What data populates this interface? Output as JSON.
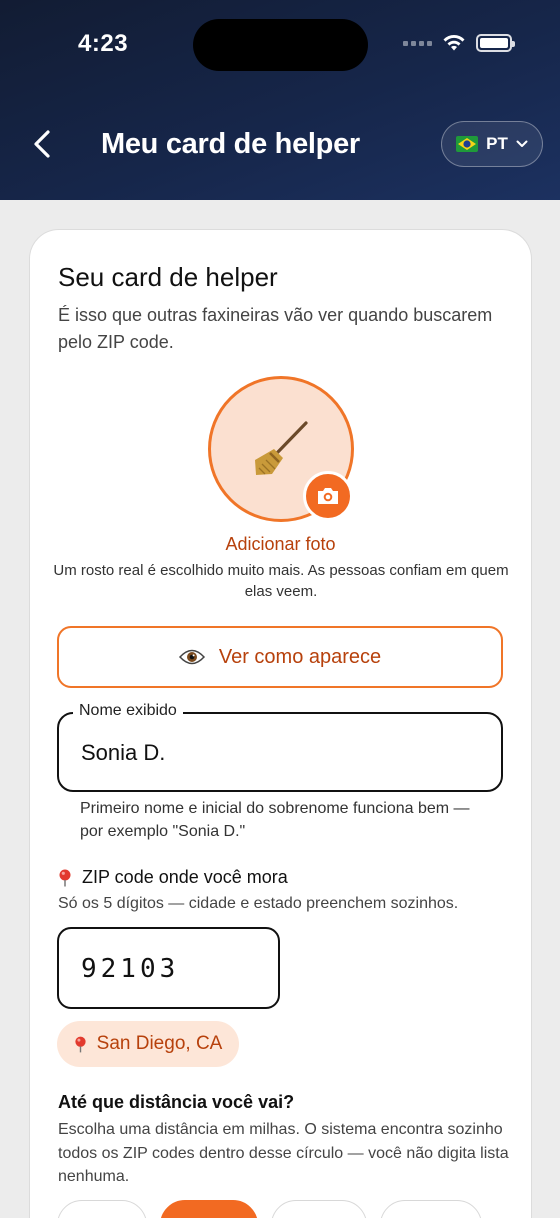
{
  "status_bar": {
    "time": "4:23"
  },
  "header": {
    "title": "Meu card de helper",
    "language": "PT",
    "language_flag": "brazil-flag-icon"
  },
  "card": {
    "title": "Seu card de helper",
    "subtitle": "É isso que outras faxineiras vão ver quando buscarem pelo ZIP code.",
    "avatar_icon": "broom-icon",
    "add_photo_label": "Adicionar foto",
    "photo_hint": "Um rosto real é escolhido muito mais. As pessoas confiam em quem elas veem.",
    "preview_button_label": "Ver como aparece",
    "name_field": {
      "label": "Nome exibido",
      "value": "Sonia D.",
      "hint": "Primeiro nome e inicial do sobrenome funciona bem — por exemplo \"Sonia D.\""
    },
    "zip": {
      "label": "ZIP code onde você mora",
      "hint": "Só os 5 dígitos — cidade e estado preenchem sozinhos.",
      "value": "92103",
      "city": "San Diego, CA"
    },
    "distance": {
      "title": "Até que distância você vai?",
      "hint": "Escolha uma distância em milhas. O sistema encontra sozinho todos os ZIP codes dentro desse círculo — você não digita lista nenhuma.",
      "options_selected_index": 1
    }
  },
  "colors": {
    "accent": "#f26a22",
    "accent_text": "#b7410c",
    "header_bg": "#16264a",
    "badge_bg": "#fde6d8"
  }
}
